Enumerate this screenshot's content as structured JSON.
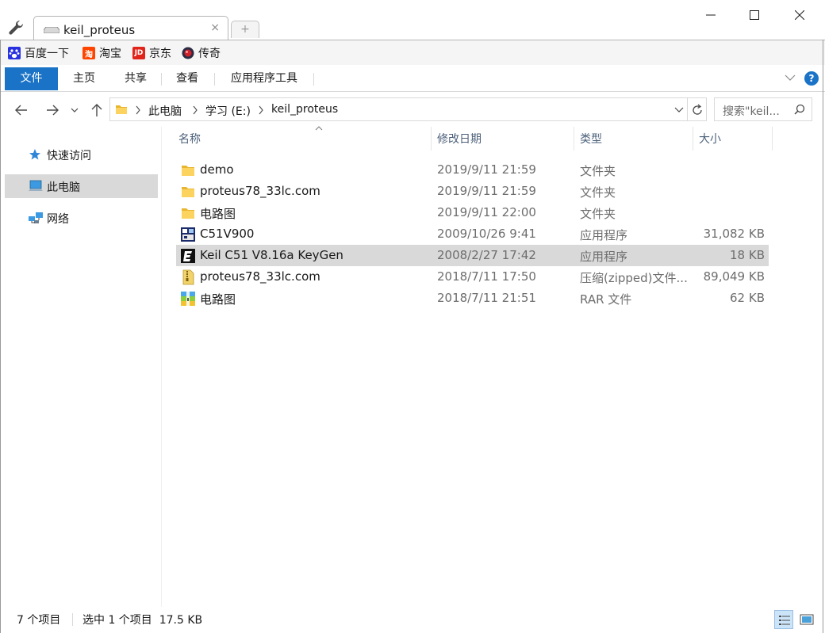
{
  "tab": {
    "title": "keil_proteus",
    "close_glyph": "×",
    "newtab_glyph": "+"
  },
  "bookmarks": [
    {
      "label": "百度一下",
      "icon": "baidu-icon",
      "color": "#2932e1"
    },
    {
      "label": "淘宝",
      "icon": "taobao-icon",
      "icon_text": "淘",
      "color": "#ff4400"
    },
    {
      "label": "京东",
      "icon": "jd-icon",
      "icon_text": "JD",
      "color": "#e1251b"
    },
    {
      "label": "传奇",
      "icon": "chuanqi-icon",
      "color": "#333333"
    }
  ],
  "ribbon": {
    "tabs": [
      "文件",
      "主页",
      "共享",
      "查看",
      "应用程序工具"
    ],
    "help_glyph": "?",
    "accent": "#1a73c7"
  },
  "address": {
    "crumbs": [
      "此电脑",
      "学习 (E:)",
      "keil_proteus"
    ],
    "search_placeholder": "搜索\"keil..."
  },
  "navpane": {
    "items": [
      {
        "label": "快速访问",
        "icon": "star-icon"
      },
      {
        "label": "此电脑",
        "icon": "computer-icon",
        "selected": true
      },
      {
        "label": "网络",
        "icon": "network-icon"
      }
    ]
  },
  "columns": {
    "name": "名称",
    "date": "修改日期",
    "type": "类型",
    "size": "大小"
  },
  "files": [
    {
      "name": "demo",
      "date": "2019/9/11 21:59",
      "type": "文件夹",
      "size": "",
      "icon": "folder-icon"
    },
    {
      "name": "proteus78_33lc.com",
      "date": "2019/9/11 21:59",
      "type": "文件夹",
      "size": "",
      "icon": "folder-icon"
    },
    {
      "name": "电路图",
      "date": "2019/9/11 22:00",
      "type": "文件夹",
      "size": "",
      "icon": "folder-icon"
    },
    {
      "name": "C51V900",
      "date": "2009/10/26 9:41",
      "type": "应用程序",
      "size": "31,082 KB",
      "icon": "installer-icon"
    },
    {
      "name": "Keil C51 V8.16a KeyGen",
      "date": "2008/2/27 17:42",
      "type": "应用程序",
      "size": "18 KB",
      "icon": "keygen-icon",
      "selected": true
    },
    {
      "name": "proteus78_33lc.com",
      "date": "2018/7/11 17:50",
      "type": "压缩(zipped)文件...",
      "size": "89,049 KB",
      "icon": "zip-icon"
    },
    {
      "name": "电路图",
      "date": "2018/7/11 21:51",
      "type": "RAR 文件",
      "size": "62 KB",
      "icon": "rar-icon"
    }
  ],
  "status": {
    "count": "7 个项目",
    "selection": "选中 1 个项目  17.5 KB"
  }
}
